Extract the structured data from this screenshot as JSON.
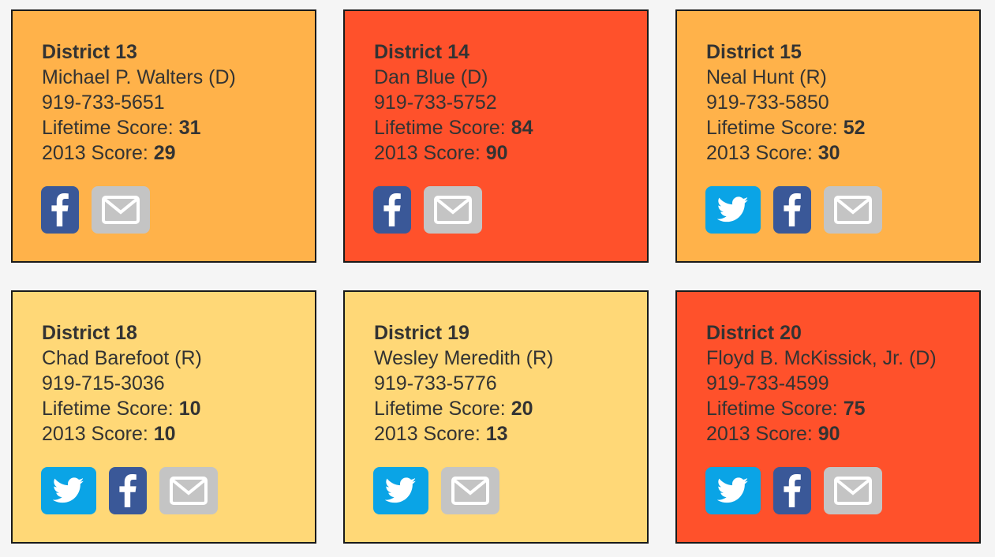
{
  "labels": {
    "lifetime": "Lifetime Score: ",
    "year": "2013 Score: "
  },
  "colors": {
    "light_orange": "#ffb24a",
    "red": "#ff512b",
    "yellow": "#ffd877",
    "twitter": "#0aa4e6",
    "facebook": "#3a5898",
    "email": "#c4c4c4"
  },
  "icons": {
    "twitter": "twitter-icon",
    "facebook": "facebook-icon",
    "email": "email-icon"
  },
  "cards": [
    {
      "district": "District 13",
      "name": "Michael P. Walters (D)",
      "phone": "919-733-5651",
      "lifetime": "31",
      "year_score": "29",
      "color": "#ffb24a",
      "icons": [
        "facebook",
        "email"
      ]
    },
    {
      "district": "District 14",
      "name": "Dan Blue (D)",
      "phone": "919-733-5752",
      "lifetime": "84",
      "year_score": "90",
      "color": "#ff512b",
      "icons": [
        "facebook",
        "email"
      ]
    },
    {
      "district": "District 15",
      "name": "Neal Hunt (R)",
      "phone": "919-733-5850",
      "lifetime": "52",
      "year_score": "30",
      "color": "#ffb24a",
      "icons": [
        "twitter",
        "facebook",
        "email"
      ]
    },
    {
      "district": "District 18",
      "name": "Chad Barefoot (R)",
      "phone": "919-715-3036",
      "lifetime": "10",
      "year_score": "10",
      "color": "#ffd877",
      "icons": [
        "twitter",
        "facebook",
        "email"
      ]
    },
    {
      "district": "District 19",
      "name": "Wesley Meredith (R)",
      "phone": "919-733-5776",
      "lifetime": "20",
      "year_score": "13",
      "color": "#ffd877",
      "icons": [
        "twitter",
        "email"
      ]
    },
    {
      "district": "District 20",
      "name": "Floyd B. McKissick, Jr. (D)",
      "phone": "919-733-4599",
      "lifetime": "75",
      "year_score": "90",
      "color": "#ff512b",
      "icons": [
        "twitter",
        "facebook",
        "email"
      ]
    }
  ]
}
